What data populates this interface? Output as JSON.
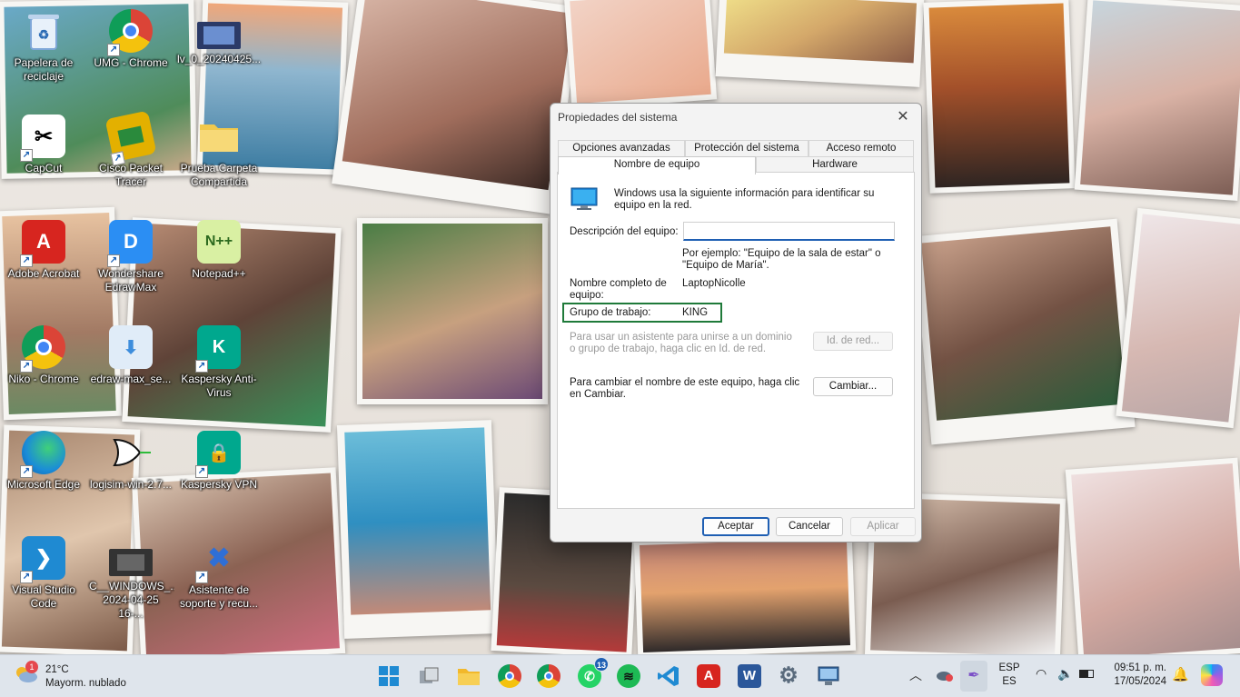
{
  "desktop": {
    "icons": [
      {
        "label": "Papelera de reciclaje",
        "icon": "recycle-bin-icon",
        "color": "#7ea7d8"
      },
      {
        "label": "UMG - Chrome",
        "icon": "chrome-icon",
        "color": "#db4437"
      },
      {
        "label": "lv_0_20240425...",
        "icon": "video-file-icon",
        "color": "#2b3a67"
      },
      {
        "label": "CapCut",
        "icon": "capcut-icon",
        "color": "#000000"
      },
      {
        "label": "Cisco Packet Tracer",
        "icon": "cisco-packet-tracer-icon",
        "color": "#e3b000"
      },
      {
        "label": "Prueba Carpeta Compartida",
        "icon": "folder-icon",
        "color": "#f2c94c"
      },
      {
        "label": "Adobe Acrobat",
        "icon": "adobe-acrobat-icon",
        "color": "#d7251f"
      },
      {
        "label": "Wondershare EdrawMax",
        "icon": "edrawmax-icon",
        "color": "#2b8ef3"
      },
      {
        "label": "Notepad++",
        "icon": "notepad-plus-plus-icon",
        "color": "#8bc34a"
      },
      {
        "label": "Niko - Chrome",
        "icon": "chrome-icon",
        "color": "#db4437"
      },
      {
        "label": "edraw-max_se...",
        "icon": "installer-icon",
        "color": "#3d8ddc"
      },
      {
        "label": "Kaspersky Anti-Virus",
        "icon": "kaspersky-icon",
        "color": "#00a88e"
      },
      {
        "label": "Microsoft Edge",
        "icon": "edge-icon",
        "color": "#1a8cd8"
      },
      {
        "label": "logisim-win-2.7...",
        "icon": "logisim-icon",
        "color": "#f4f4f4"
      },
      {
        "label": "Kaspersky VPN",
        "icon": "kaspersky-vpn-icon",
        "color": "#00a88e"
      },
      {
        "label": "Visual Studio Code",
        "icon": "vscode-icon",
        "color": "#1f8ad2"
      },
      {
        "label": "C__WINDOWS_... 2024-04-25 16-...",
        "icon": "video-file-icon",
        "color": "#333333"
      },
      {
        "label": "Asistente de soporte y recu...",
        "icon": "support-assistant-icon",
        "color": "#2f6fd6"
      }
    ]
  },
  "dialog": {
    "title": "Propiedades del sistema",
    "close_glyph": "✕",
    "tabs_back": [
      "Opciones avanzadas",
      "Protección del sistema",
      "Acceso remoto"
    ],
    "tabs_front": [
      "Nombre de equipo",
      "Hardware"
    ],
    "intro": "Windows usa la siguiente información para identificar su equipo en la red.",
    "description_label": "Descripción del equipo:",
    "description_value": "",
    "example": "Por ejemplo: \"Equipo de la sala de estar\" o \"Equipo de María\".",
    "fullname_label": "Nombre completo de equipo:",
    "fullname_value": "LaptopNicolle",
    "workgroup_label": "Grupo de trabajo:",
    "workgroup_value": "KING",
    "domain_hint": "Para usar un asistente para unirse a un dominio o grupo de trabajo, haga clic en Id. de red.",
    "network_id_button": "Id. de red...",
    "rename_hint": "Para cambiar el nombre de este equipo, haga clic en Cambiar.",
    "change_button": "Cambiar...",
    "ok_button": "Aceptar",
    "cancel_button": "Cancelar",
    "apply_button": "Aplicar"
  },
  "taskbar": {
    "weather_temp": "21°C",
    "weather_desc": "Mayorm. nublado",
    "weather_badge": "1",
    "whatsapp_badge": "13",
    "lang_top": "ESP",
    "lang_bottom": "ES",
    "time": "09:51 p. m.",
    "date": "17/05/2024",
    "apps": [
      {
        "name": "start-button",
        "icon": "windows-start-icon",
        "color": "#1f8ad2"
      },
      {
        "name": "task-view-button",
        "icon": "task-view-icon",
        "color": "#6b6b6b"
      },
      {
        "name": "file-explorer-button",
        "icon": "folder-icon",
        "color": "#f2b82b"
      },
      {
        "name": "chrome-profile-1-button",
        "icon": "chrome-icon",
        "color": "#db4437"
      },
      {
        "name": "chrome-profile-2-button",
        "icon": "chrome-icon",
        "color": "#db4437"
      },
      {
        "name": "whatsapp-button",
        "icon": "whatsapp-icon",
        "color": "#25d366"
      },
      {
        "name": "spotify-button",
        "icon": "spotify-icon",
        "color": "#1db954"
      },
      {
        "name": "vscode-button",
        "icon": "vscode-icon",
        "color": "#1f8ad2"
      },
      {
        "name": "acrobat-button",
        "icon": "adobe-acrobat-icon",
        "color": "#d7251f"
      },
      {
        "name": "word-button",
        "icon": "word-icon",
        "color": "#2b579a"
      },
      {
        "name": "settings-button",
        "icon": "gear-icon",
        "color": "#5a6b7d"
      },
      {
        "name": "system-properties-button",
        "icon": "computer-icon",
        "color": "#3a6ea5"
      }
    ]
  }
}
